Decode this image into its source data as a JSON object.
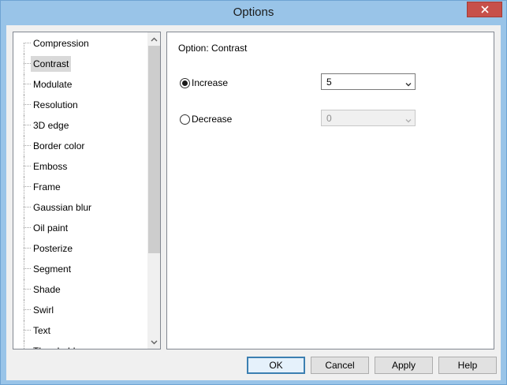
{
  "window": {
    "title": "Options"
  },
  "tree": {
    "items": [
      {
        "label": "Compression",
        "selected": false
      },
      {
        "label": "Contrast",
        "selected": true
      },
      {
        "label": "Modulate",
        "selected": false
      },
      {
        "label": "Resolution",
        "selected": false
      },
      {
        "label": "3D edge",
        "selected": false
      },
      {
        "label": "Border color",
        "selected": false
      },
      {
        "label": "Emboss",
        "selected": false
      },
      {
        "label": "Frame",
        "selected": false
      },
      {
        "label": "Gaussian blur",
        "selected": false
      },
      {
        "label": "Oil paint",
        "selected": false
      },
      {
        "label": "Posterize",
        "selected": false
      },
      {
        "label": "Segment",
        "selected": false
      },
      {
        "label": "Shade",
        "selected": false
      },
      {
        "label": "Swirl",
        "selected": false
      },
      {
        "label": "Text",
        "selected": false
      },
      {
        "label": "Threshold",
        "selected": false
      }
    ]
  },
  "panel": {
    "title": "Option: Contrast",
    "increase": {
      "label": "Increase",
      "checked": true,
      "value": "5"
    },
    "decrease": {
      "label": "Decrease",
      "checked": false,
      "value": "0"
    }
  },
  "buttons": {
    "ok": "OK",
    "cancel": "Cancel",
    "apply": "Apply",
    "help": "Help"
  },
  "icons": {
    "close": "close-icon",
    "scroll_up": "chevron-up-icon",
    "scroll_down": "chevron-down-icon",
    "combo_caret": "chevron-down-icon"
  }
}
